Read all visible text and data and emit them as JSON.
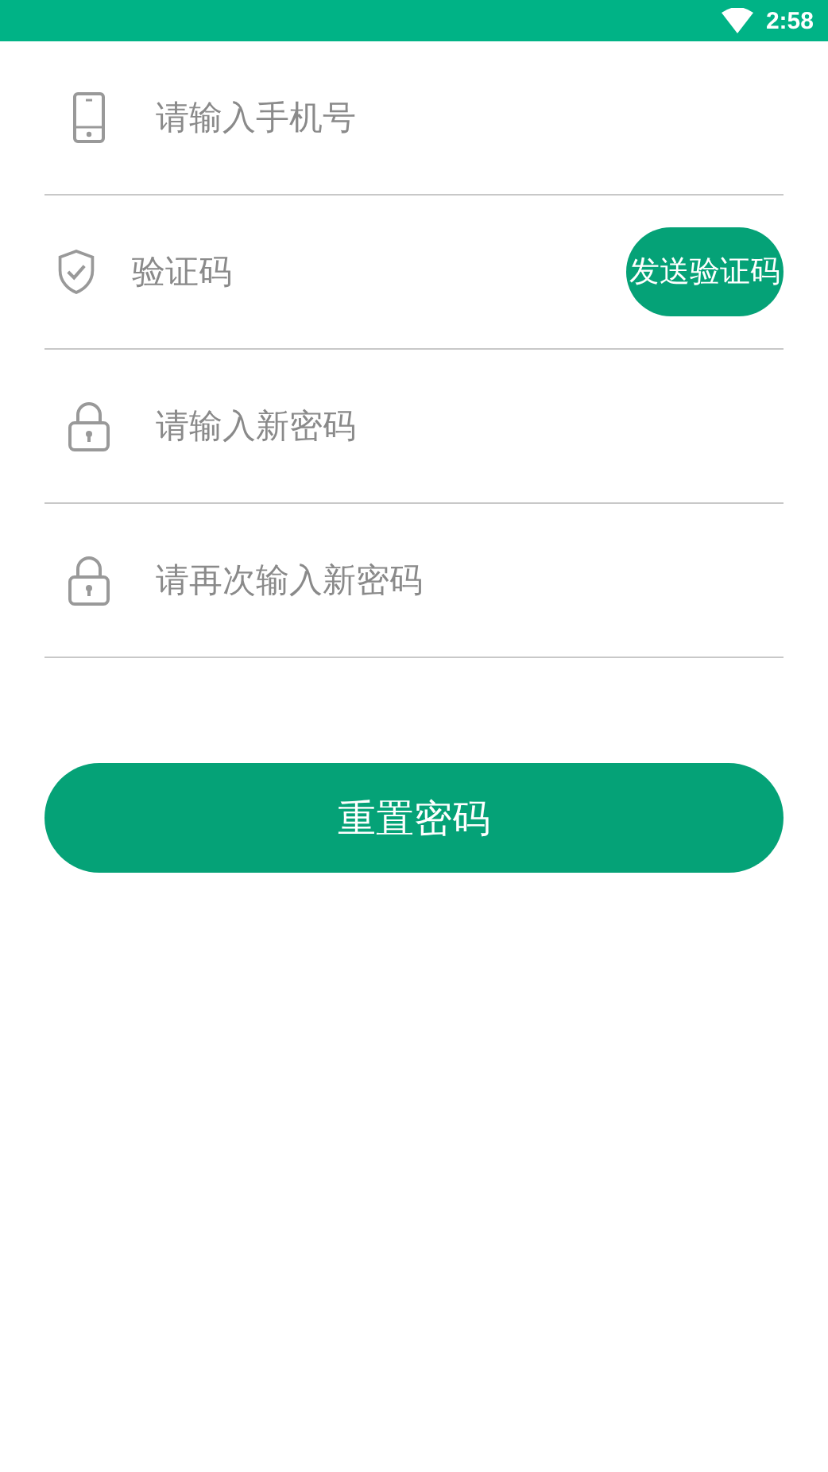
{
  "status_bar": {
    "time": "2:58"
  },
  "fields": [
    {
      "kind": "phone",
      "placeholder": "请输入手机号"
    },
    {
      "kind": "code",
      "placeholder": "验证码",
      "button": "发送验证码"
    },
    {
      "kind": "lock",
      "placeholder": "请输入新密码"
    },
    {
      "kind": "lock",
      "placeholder": "请再次输入新密码"
    }
  ],
  "submit": "重置密码"
}
